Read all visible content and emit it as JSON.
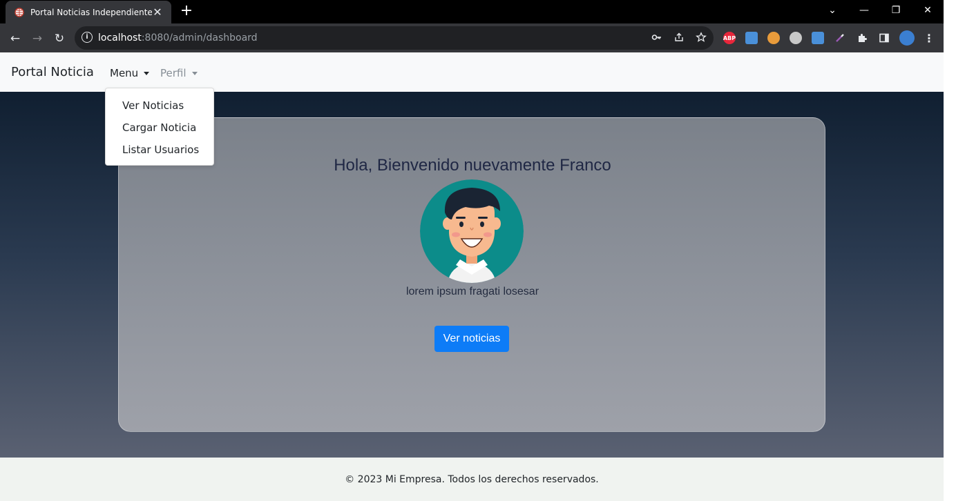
{
  "browser": {
    "tab_title": "Portal Noticias Independientes",
    "tab_close": "✕",
    "new_tab": "+",
    "window_controls": {
      "chevron": "⌄",
      "minimize": "—",
      "restore": "❐",
      "close": "✕"
    },
    "url_host": "localhost",
    "url_rest": ":8080/admin/dashboard",
    "nav_back": "←",
    "nav_forward": "→",
    "nav_reload": "↻",
    "extensions": {
      "adblock_label": "ABP",
      "colors": {
        "adblock": "#e8263b",
        "blue": "#4a90d9",
        "orange": "#e89b3b",
        "gray": "#c8c8c8",
        "profile": "#3b7fd1"
      }
    }
  },
  "navbar": {
    "brand": "Portal Noticia",
    "menu_label": "Menu",
    "profile_label": "Perfil"
  },
  "dropdown": {
    "items": [
      "Ver Noticias",
      "Cargar Noticia",
      "Listar Usuarios"
    ]
  },
  "hero": {
    "welcome": "Hola, Bienvenido nuevamente Franco",
    "caption": "lorem ipsum fragati losesar",
    "button_label": "Ver noticias",
    "colors": {
      "button": "#0d7cf7",
      "avatar_bg": "#0c8c8a",
      "avatar_hair": "#1a2433",
      "avatar_skin": "#f7b98f"
    }
  },
  "footer": {
    "text": "© 2023 Mi Empresa. Todos los derechos reservados."
  }
}
